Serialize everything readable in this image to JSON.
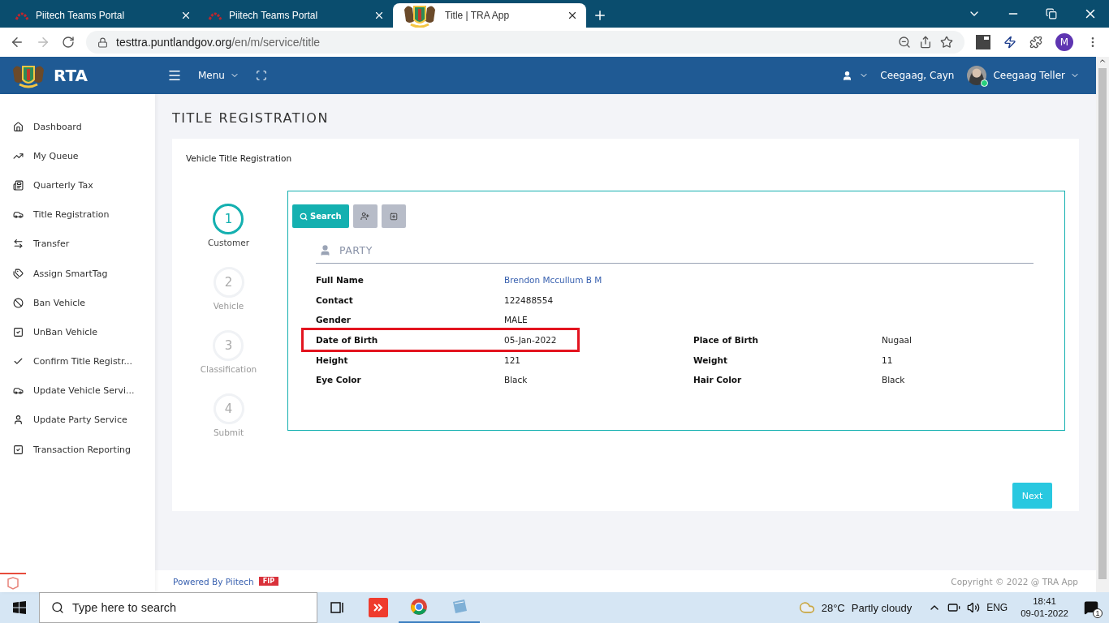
{
  "browser": {
    "tabs": [
      {
        "title": "Piitech Teams Portal",
        "selected": false
      },
      {
        "title": "Piitech Teams Portal",
        "selected": false
      },
      {
        "title": "Title | TRA App",
        "selected": true
      }
    ],
    "url": {
      "host": "testtra.puntlandgov.org",
      "path": "/en/m/service/title"
    },
    "profile": "M"
  },
  "header": {
    "brand": "RTA",
    "menu": "Menu",
    "user_short": "Ceegaag, Cayn",
    "user_name": "Ceegaag Teller"
  },
  "sidebar": {
    "items": [
      {
        "label": "Dashboard"
      },
      {
        "label": "My Queue"
      },
      {
        "label": "Quarterly Tax"
      },
      {
        "label": "Title Registration"
      },
      {
        "label": "Transfer"
      },
      {
        "label": "Assign SmartTag"
      },
      {
        "label": "Ban Vehicle"
      },
      {
        "label": "UnBan Vehicle"
      },
      {
        "label": "Confirm Title Registr..."
      },
      {
        "label": "Update Vehicle Servi..."
      },
      {
        "label": "Update Party Service"
      },
      {
        "label": "Transaction Reporting"
      }
    ]
  },
  "page_title": "TITLE REGISTRATION",
  "card_title": "Vehicle Title Registration",
  "steps": [
    {
      "number": "1",
      "label": "Customer",
      "selected": true
    },
    {
      "number": "2",
      "label": "Vehicle",
      "selected": false
    },
    {
      "number": "3",
      "label": "Classification",
      "selected": false
    },
    {
      "number": "4",
      "label": "Submit",
      "selected": false
    }
  ],
  "search_button": "Search",
  "section_title": "PARTY",
  "rows": [
    {
      "cells": [
        {
          "label": "Full Name",
          "value": "Brendon Mccullum B M",
          "kind": "link",
          "highlighted": false
        }
      ]
    },
    {
      "cells": [
        {
          "label": "Contact",
          "value": "122488554",
          "kind": "text",
          "highlighted": false
        }
      ]
    },
    {
      "cells": [
        {
          "label": "Gender",
          "value": "MALE",
          "kind": "text",
          "highlighted": false
        }
      ]
    },
    {
      "cells": [
        {
          "label": "Date of Birth",
          "value": "05-Jan-2022",
          "kind": "text",
          "highlighted": true
        },
        {
          "label": "Place of Birth",
          "value": "Nugaal",
          "kind": "text",
          "highlighted": false
        }
      ]
    },
    {
      "cells": [
        {
          "label": "Height",
          "value": "121",
          "kind": "text",
          "highlighted": false
        },
        {
          "label": "Weight",
          "value": "11",
          "kind": "text",
          "highlighted": false
        }
      ]
    },
    {
      "cells": [
        {
          "label": "Eye Color",
          "value": "Black",
          "kind": "text",
          "highlighted": false
        },
        {
          "label": "Hair Color",
          "value": "Black",
          "kind": "text",
          "highlighted": false
        }
      ]
    }
  ],
  "next_button": "Next",
  "footer": {
    "powered": "Powered By Piitech",
    "badge": "FIP",
    "copyright": "Copyright © 2022 @ TRA App"
  },
  "taskbar": {
    "search_placeholder": "Type here to search",
    "temperature": "28°C",
    "weather": "Partly cloudy",
    "language": "ENG",
    "time": "18:41",
    "date": "09-01-2022",
    "notifications": "1"
  }
}
